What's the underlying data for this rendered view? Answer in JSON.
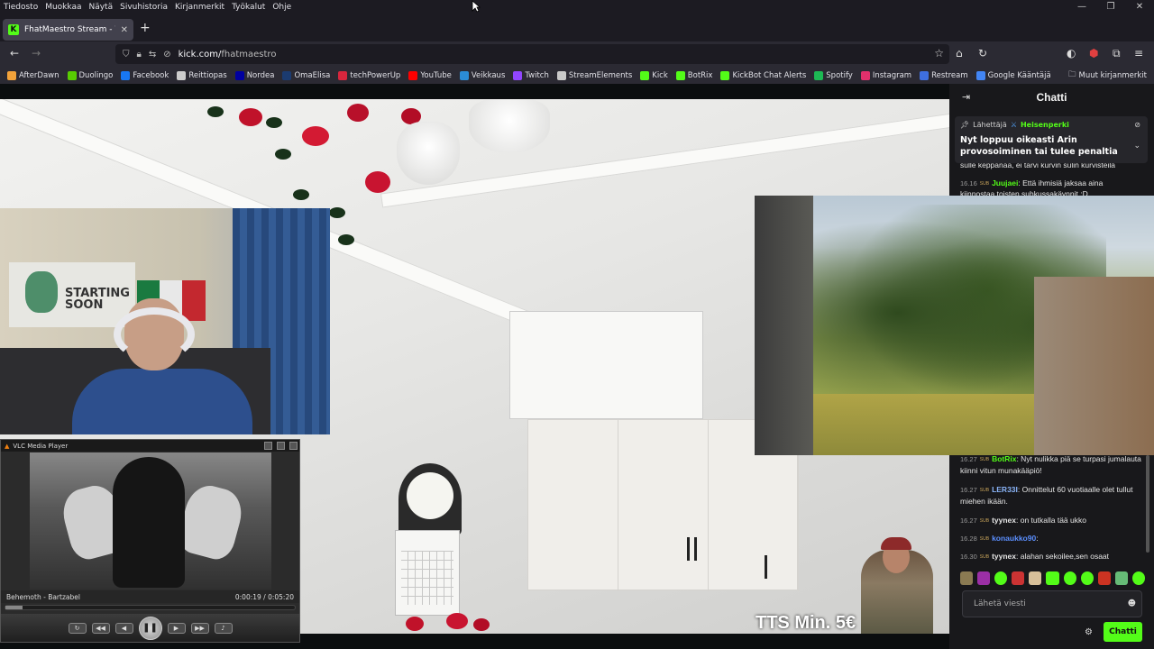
{
  "menubar": {
    "items": [
      "Tiedosto",
      "Muokkaa",
      "Näytä",
      "Sivuhistoria",
      "Kirjanmerkit",
      "Työkalut",
      "Ohje"
    ]
  },
  "tab": {
    "title": "FhatMaestro Stream - Wat",
    "new_tab": "+"
  },
  "navbar": {
    "url_prefix": "kick.com/",
    "url_path": "fhatmaestro"
  },
  "bookmarks": {
    "items": [
      {
        "label": "AfterDawn",
        "color": "#f2a23a"
      },
      {
        "label": "Duolingo",
        "color": "#58cc02"
      },
      {
        "label": "Facebook",
        "color": "#1877f2"
      },
      {
        "label": "Reittiopas",
        "color": "#cccccc"
      },
      {
        "label": "Nordea",
        "color": "#0000a0"
      },
      {
        "label": "OmaElisa",
        "color": "#1b3b70"
      },
      {
        "label": "techPowerUp",
        "color": "#d7263d"
      },
      {
        "label": "YouTube",
        "color": "#ff0000"
      },
      {
        "label": "Veikkaus",
        "color": "#2b8cd6"
      },
      {
        "label": "Twitch",
        "color": "#9146ff"
      },
      {
        "label": "StreamElements",
        "color": "#c9c9c9"
      },
      {
        "label": "Kick",
        "color": "#53fc18"
      },
      {
        "label": "BotRix",
        "color": "#53fc18"
      },
      {
        "label": "KickBot Chat Alerts",
        "color": "#53fc18"
      },
      {
        "label": "Spotify",
        "color": "#1db954"
      },
      {
        "label": "Instagram",
        "color": "#e1306c"
      },
      {
        "label": "Restream",
        "color": "#3e6fe0"
      },
      {
        "label": "Google Kääntäjä",
        "color": "#4285f4"
      }
    ],
    "other": "Muut kirjanmerkit"
  },
  "stream": {
    "tts_text": "TTS Min. 5€"
  },
  "webcam": {
    "poster_text": "STARTING\nSOON"
  },
  "vlc": {
    "title": "VLC Media Player",
    "track": "Behemoth - Bartzabel",
    "time": "0:00:19 / 0:05:20",
    "progress": 0.06
  },
  "chat": {
    "title": "Chatti",
    "pinned": {
      "sender_label": "Lähettäjä",
      "user": "Heisenperki",
      "message": "Nyt loppuu oikeasti Arin provosoiminen tai tulee penaltia"
    },
    "messages_top": [
      {
        "time": "",
        "user": "",
        "text": "sulle keppanaa, ei tarvi kurvin sulin kurvisteila",
        "user_color": "#e6e6e6"
      },
      {
        "time": "16.16",
        "user": "Juujaei",
        "text": ": Että ihmisiä jaksaa aina",
        "user_color": "#53fc18"
      },
      {
        "time": "",
        "user": "",
        "text": "kiinnostaa toisten suhkussakäynnit :D",
        "user_color": "#e6e6e6"
      }
    ],
    "messages": [
      {
        "time": "16.27",
        "user": "BotRix",
        "text": ": Nyt nulikka piä se turpasi jumalauta kiinni vitun munakääpiö!",
        "user_color": "#53fc18"
      },
      {
        "time": "16.27",
        "user": "LER33I",
        "text": ": Onnittelut 60 vuotiaalle olet tullut miehen ikään.",
        "user_color": "#8ab4f8"
      },
      {
        "time": "16.27",
        "user": "tyynex",
        "text": ": on tutkalla tää ukko",
        "user_color": "#e6e6e6"
      },
      {
        "time": "16.28",
        "user": "konaukko90",
        "text": ":",
        "user_color": "#5b8fff"
      },
      {
        "time": "16.30",
        "user": "tyynex",
        "text": ": alahan sekoilee,sen osaat",
        "user_color": "#e6e6e6"
      }
    ],
    "input_placeholder": "Lähetä viesti",
    "send_label": "Chatti"
  }
}
